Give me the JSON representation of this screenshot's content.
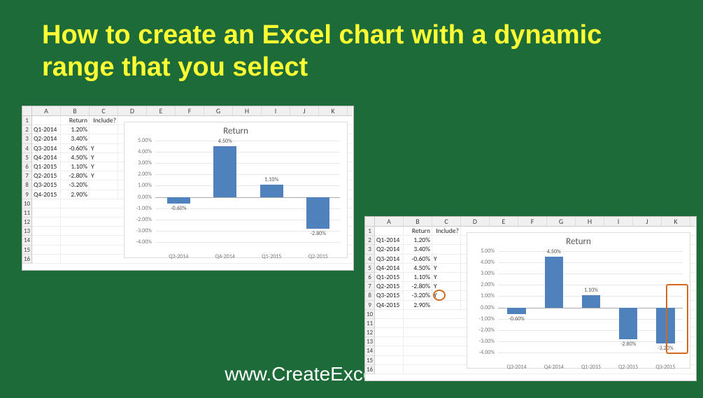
{
  "title": "How to create an Excel chart with a dynamic range that you select",
  "footer_url": "www.CreateExcelCharts.com",
  "columns": [
    "A",
    "B",
    "C",
    "D",
    "E",
    "F",
    "G",
    "H",
    "I",
    "J",
    "K"
  ],
  "rows": [
    "1",
    "2",
    "3",
    "4",
    "5",
    "6",
    "7",
    "8",
    "9",
    "10",
    "11",
    "12",
    "13",
    "14",
    "15",
    "16"
  ],
  "left": {
    "headers": {
      "A": "",
      "B": "Return",
      "C": "Include?"
    },
    "data": [
      {
        "q": "Q1-2014",
        "ret": "1.20%",
        "inc": ""
      },
      {
        "q": "Q2-2014",
        "ret": "3.40%",
        "inc": ""
      },
      {
        "q": "Q3-2014",
        "ret": "-0.60%",
        "inc": "Y"
      },
      {
        "q": "Q4-2014",
        "ret": "4.50%",
        "inc": "Y"
      },
      {
        "q": "Q1-2015",
        "ret": "1.10%",
        "inc": "Y"
      },
      {
        "q": "Q2-2015",
        "ret": "-2.80%",
        "inc": "Y"
      },
      {
        "q": "Q3-2015",
        "ret": "-3.20%",
        "inc": ""
      },
      {
        "q": "Q4-2015",
        "ret": "2.90%",
        "inc": ""
      }
    ],
    "chart": {
      "title": "Return",
      "ymin": -4.0,
      "ymax": 5.0,
      "yticks": [
        "5.00%",
        "4.00%",
        "3.00%",
        "2.00%",
        "1.00%",
        "0.00%",
        "-1.00%",
        "-2.00%",
        "-3.00%",
        "-4.00%"
      ],
      "categories": [
        "Q3-2014",
        "Q4-2014",
        "Q1-2015",
        "Q2-2015"
      ],
      "values": [
        -0.6,
        4.5,
        1.1,
        -2.8
      ],
      "labels": [
        "-0.60%",
        "4.50%",
        "1.10%",
        "-2.80%"
      ]
    }
  },
  "right": {
    "headers": {
      "A": "",
      "B": "Return",
      "C": "Include?"
    },
    "data": [
      {
        "q": "Q1-2014",
        "ret": "1.20%",
        "inc": ""
      },
      {
        "q": "Q2-2014",
        "ret": "3.40%",
        "inc": ""
      },
      {
        "q": "Q3-2014",
        "ret": "-0.60%",
        "inc": "Y"
      },
      {
        "q": "Q4-2014",
        "ret": "4.50%",
        "inc": "Y"
      },
      {
        "q": "Q1-2015",
        "ret": "1.10%",
        "inc": "Y"
      },
      {
        "q": "Q2-2015",
        "ret": "-2.80%",
        "inc": "Y"
      },
      {
        "q": "Q3-2015",
        "ret": "-3.20%",
        "inc": "Y"
      },
      {
        "q": "Q4-2015",
        "ret": "2.90%",
        "inc": ""
      }
    ],
    "chart": {
      "title": "Return",
      "ymin": -4.0,
      "ymax": 5.0,
      "yticks": [
        "5.00%",
        "4.00%",
        "3.00%",
        "2.00%",
        "1.00%",
        "0.00%",
        "-1.00%",
        "-2.00%",
        "-3.00%",
        "-4.00%"
      ],
      "categories": [
        "Q3-2014",
        "Q4-2014",
        "Q1-2015",
        "Q2-2015",
        "Q3-2015"
      ],
      "values": [
        -0.6,
        4.5,
        1.1,
        -2.8,
        -3.2
      ],
      "labels": [
        "-0.60%",
        "4.50%",
        "1.10%",
        "-2.80%",
        "-3.20%"
      ]
    }
  },
  "chart_data": [
    {
      "type": "bar",
      "title": "Return",
      "categories": [
        "Q3-2014",
        "Q4-2014",
        "Q1-2015",
        "Q2-2015"
      ],
      "values": [
        -0.6,
        4.5,
        1.1,
        -2.8
      ],
      "ylabel": "",
      "xlabel": "",
      "ylim": [
        -4.0,
        5.0
      ]
    },
    {
      "type": "bar",
      "title": "Return",
      "categories": [
        "Q3-2014",
        "Q4-2014",
        "Q1-2015",
        "Q2-2015",
        "Q3-2015"
      ],
      "values": [
        -0.6,
        4.5,
        1.1,
        -2.8,
        -3.2
      ],
      "ylabel": "",
      "xlabel": "",
      "ylim": [
        -4.0,
        5.0
      ]
    }
  ]
}
